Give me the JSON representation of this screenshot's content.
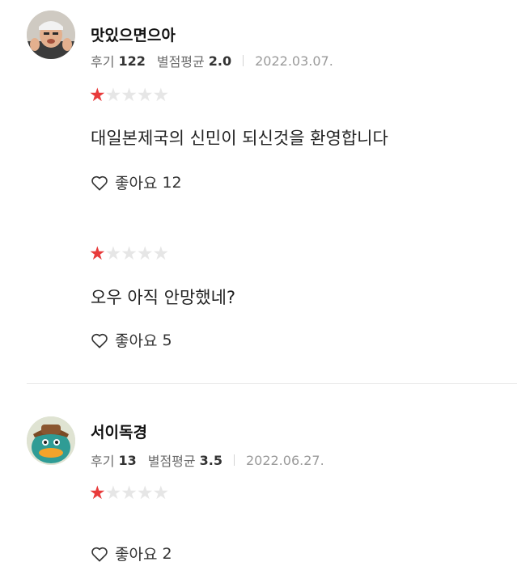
{
  "reviews": [
    {
      "nickname": "맛있으면으아",
      "review_count_label": "후기",
      "review_count": "122",
      "avg_rating_label": "별점평균",
      "avg_rating": "2.0",
      "date": "2022.03.07.",
      "entries": [
        {
          "rating": 1,
          "text": "대일본제국의 신민이 되신것을 환영합니다",
          "like_label": "좋아요",
          "like_count": "12"
        },
        {
          "rating": 1,
          "text": "오우 아직 안망했네?",
          "like_label": "좋아요",
          "like_count": "5"
        }
      ]
    },
    {
      "nickname": "서이독경",
      "review_count_label": "후기",
      "review_count": "13",
      "avg_rating_label": "별점평균",
      "avg_rating": "3.5",
      "date": "2022.06.27.",
      "entries": [
        {
          "rating": 1,
          "text": "",
          "like_label": "좋아요",
          "like_count": "2"
        }
      ]
    }
  ],
  "star_max": 5,
  "colors": {
    "star_on": "#e83b3b",
    "star_off": "#e6e6e6",
    "divider": "#e8e8e8"
  },
  "icons": {
    "like": "heart-outline-icon",
    "star": "star-icon"
  }
}
